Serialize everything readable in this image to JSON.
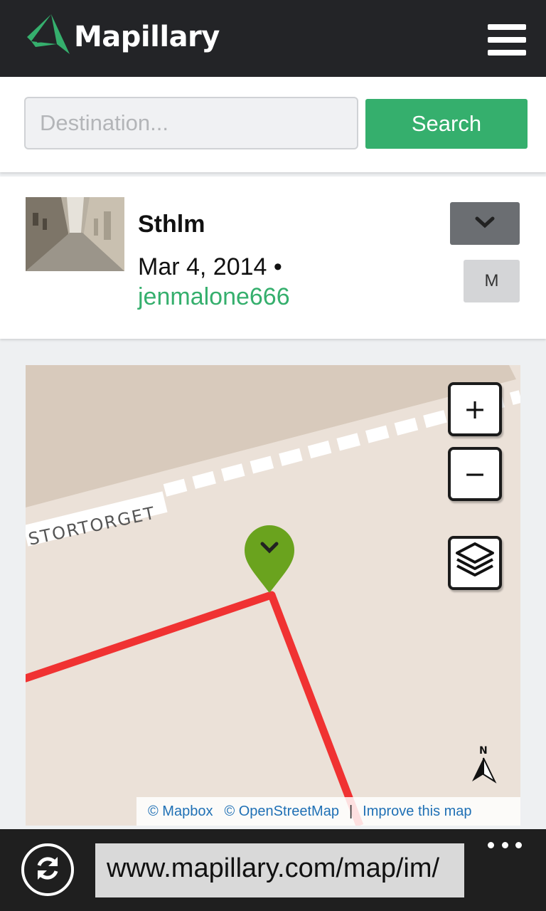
{
  "header": {
    "brand": "Mapillary",
    "logo_icon": "mapillary-logo-icon",
    "menu_icon": "hamburger-menu-icon"
  },
  "search": {
    "placeholder": "Destination...",
    "value": "",
    "button_label": "Search"
  },
  "card": {
    "title": "Sthlm",
    "date": "Mar 4, 2014 •",
    "user": "jenmalone666",
    "expand_icon": "chevron-down-icon",
    "m_button_label": "M"
  },
  "map": {
    "street_label": "STORTORGET",
    "zoom_in": "+",
    "zoom_out": "−",
    "layers_icon": "layers-icon",
    "north_label": "N",
    "marker_icon": "map-marker-icon",
    "track_color": "#f03232",
    "marker_color": "#6aa31e",
    "attribution": {
      "mapbox": "© Mapbox",
      "osm": "© OpenStreetMap",
      "separator": "|",
      "improve": "Improve this map"
    }
  },
  "browser": {
    "url": "www.mapillary.com/map/im/",
    "refresh_icon": "refresh-icon",
    "more_icon": "more-dots-icon"
  },
  "colors": {
    "accent": "#35af6d",
    "header_bg": "#232427"
  }
}
